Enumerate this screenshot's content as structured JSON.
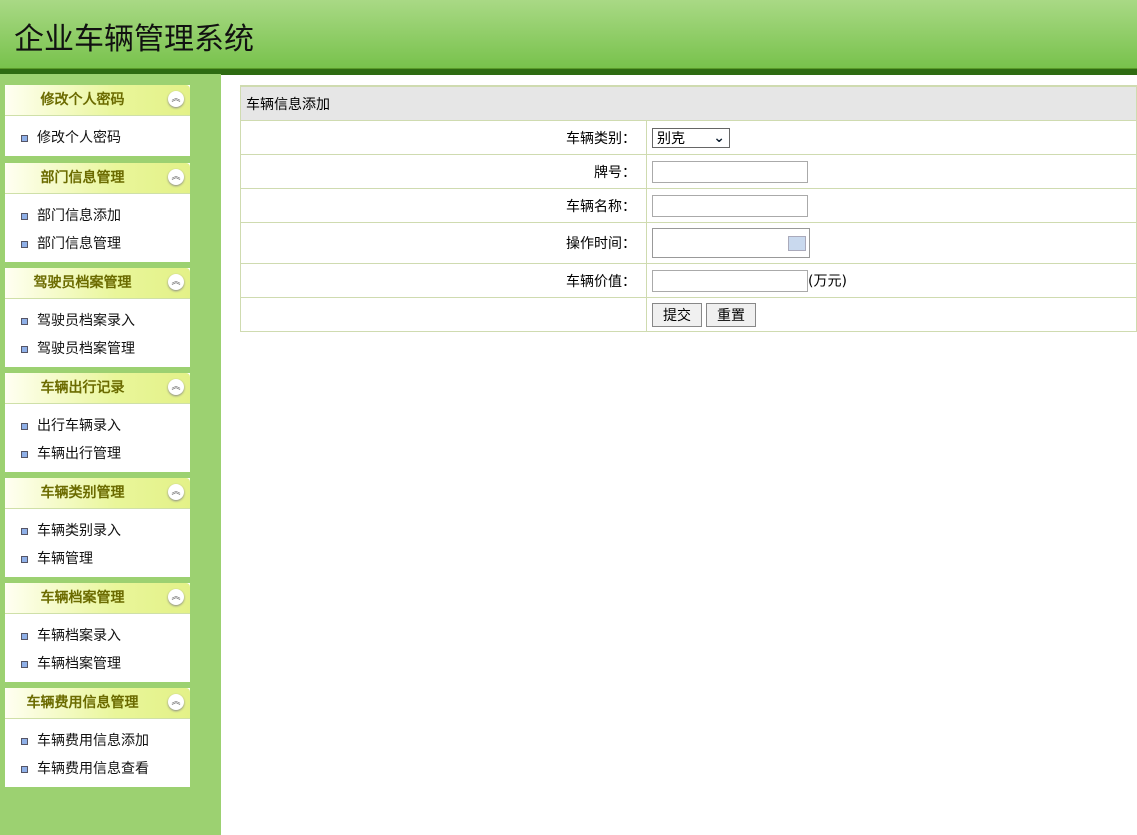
{
  "app": {
    "title": "企业车辆管理系统"
  },
  "sidebar": {
    "sections": [
      {
        "title": "修改个人密码",
        "items": [
          "修改个人密码"
        ]
      },
      {
        "title": "部门信息管理",
        "items": [
          "部门信息添加",
          "部门信息管理"
        ]
      },
      {
        "title": "驾驶员档案管理",
        "items": [
          "驾驶员档案录入",
          "驾驶员档案管理"
        ]
      },
      {
        "title": "车辆出行记录",
        "items": [
          "出行车辆录入",
          "车辆出行管理"
        ]
      },
      {
        "title": "车辆类别管理",
        "items": [
          "车辆类别录入",
          "车辆管理"
        ]
      },
      {
        "title": "车辆档案管理",
        "items": [
          "车辆档案录入",
          "车辆档案管理"
        ]
      },
      {
        "title": "车辆费用信息管理",
        "items": [
          "车辆费用信息添加",
          "车辆费用信息查看"
        ]
      }
    ]
  },
  "form": {
    "title": "车辆信息添加",
    "category_label": "车辆类别：",
    "category_value": "别克",
    "plate_label": "牌号：",
    "plate_value": "",
    "name_label": "车辆名称：",
    "name_value": "",
    "time_label": "操作时间：",
    "time_value": "",
    "price_label": "车辆价值：",
    "price_value": "",
    "price_unit": "(万元)",
    "submit": "提交",
    "reset": "重置"
  }
}
